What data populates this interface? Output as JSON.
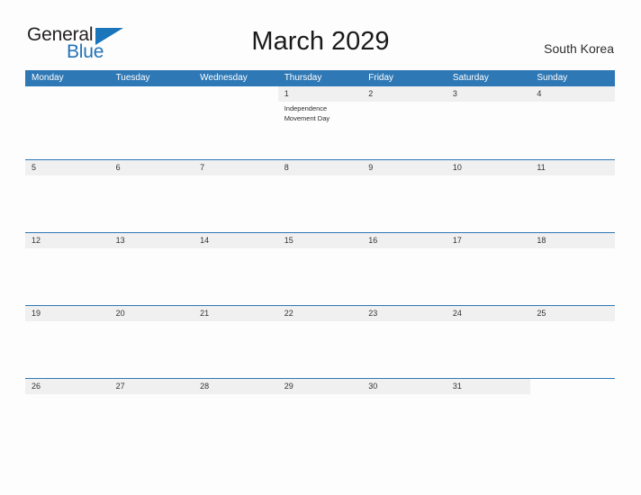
{
  "brand": {
    "name_part1": "General",
    "name_part2": "Blue",
    "triangle_icon": "triangle-icon",
    "accent_color": "#1b75bb"
  },
  "header": {
    "title": "March 2029",
    "region": "South Korea"
  },
  "theme": {
    "header_blue": "#2e78b5",
    "band_gray": "#f0f0f0",
    "page_background": "#fdfdfd",
    "text_color": "#333333"
  },
  "calendar": {
    "month": "March",
    "year": "2029",
    "weekday_headers": [
      "Monday",
      "Tuesday",
      "Wednesday",
      "Thursday",
      "Friday",
      "Saturday",
      "Sunday"
    ],
    "weeks": [
      {
        "days": [
          {
            "number": "",
            "events": []
          },
          {
            "number": "",
            "events": []
          },
          {
            "number": "",
            "events": []
          },
          {
            "number": "1",
            "events": [
              "Independence Movement Day"
            ]
          },
          {
            "number": "2",
            "events": []
          },
          {
            "number": "3",
            "events": []
          },
          {
            "number": "4",
            "events": []
          }
        ]
      },
      {
        "days": [
          {
            "number": "5",
            "events": []
          },
          {
            "number": "6",
            "events": []
          },
          {
            "number": "7",
            "events": []
          },
          {
            "number": "8",
            "events": []
          },
          {
            "number": "9",
            "events": []
          },
          {
            "number": "10",
            "events": []
          },
          {
            "number": "11",
            "events": []
          }
        ]
      },
      {
        "days": [
          {
            "number": "12",
            "events": []
          },
          {
            "number": "13",
            "events": []
          },
          {
            "number": "14",
            "events": []
          },
          {
            "number": "15",
            "events": []
          },
          {
            "number": "16",
            "events": []
          },
          {
            "number": "17",
            "events": []
          },
          {
            "number": "18",
            "events": []
          }
        ]
      },
      {
        "days": [
          {
            "number": "19",
            "events": []
          },
          {
            "number": "20",
            "events": []
          },
          {
            "number": "21",
            "events": []
          },
          {
            "number": "22",
            "events": []
          },
          {
            "number": "23",
            "events": []
          },
          {
            "number": "24",
            "events": []
          },
          {
            "number": "25",
            "events": []
          }
        ]
      },
      {
        "days": [
          {
            "number": "26",
            "events": []
          },
          {
            "number": "27",
            "events": []
          },
          {
            "number": "28",
            "events": []
          },
          {
            "number": "29",
            "events": []
          },
          {
            "number": "30",
            "events": []
          },
          {
            "number": "31",
            "events": []
          },
          {
            "number": "",
            "events": []
          }
        ]
      }
    ]
  }
}
